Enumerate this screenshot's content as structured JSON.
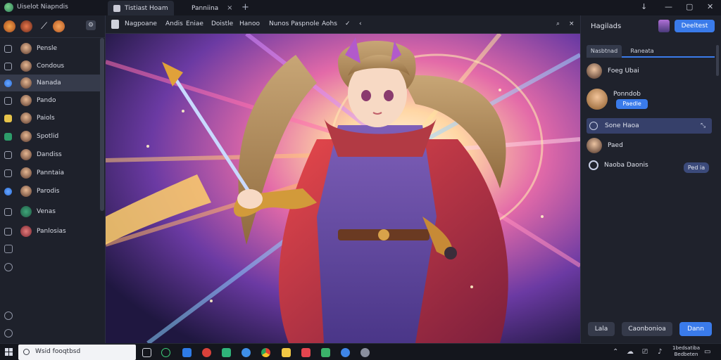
{
  "titlebar": {
    "app_title": "Uiselot Niapndis",
    "tabs": [
      {
        "label": "Tistiast Hoam",
        "close": "×",
        "active": true
      },
      {
        "label": "Panniina",
        "close": "×",
        "active": false
      }
    ],
    "new_tab": "+",
    "window_controls": [
      "↓",
      "—",
      "▢",
      "✕"
    ]
  },
  "sidebar": {
    "top_icons": [
      "flame-icon",
      "avatar-icon",
      "brush-icon",
      "coin-icon",
      "settings-icon"
    ],
    "items": [
      {
        "label": "Pensle",
        "icon": "pencil-icon",
        "selected": false
      },
      {
        "label": "Condous",
        "icon": "image-icon",
        "selected": false
      },
      {
        "label": "Nanada",
        "icon": "globe-icon",
        "selected": true
      },
      {
        "label": "Pando",
        "icon": "frame-icon",
        "selected": false
      },
      {
        "label": "Paiols",
        "icon": "folder-icon",
        "selected": false
      },
      {
        "label": "Spotlid",
        "icon": "chart-icon",
        "selected": false
      },
      {
        "label": "Dandiss",
        "icon": "square-icon",
        "selected": false
      },
      {
        "label": "Panntaia",
        "icon": "grid-icon",
        "selected": false
      },
      {
        "label": "Parodis",
        "icon": "circle-icon",
        "selected": false
      },
      {
        "label": "Venas",
        "icon": "box-icon",
        "selected": false
      },
      {
        "label": "Panlosias",
        "icon": "tile-icon",
        "selected": false
      }
    ],
    "bottom_icons": [
      "layers-icon",
      "refresh-icon",
      "help-icon",
      "info-icon"
    ]
  },
  "toolbar": {
    "items": [
      "Nagpoane",
      "Andis",
      "Eniae",
      "Doistle",
      "Hanoo",
      "Nunos Paspnole",
      "Aohs"
    ],
    "actions": [
      "✓",
      "‹"
    ],
    "right_actions": [
      "⌕",
      "×"
    ]
  },
  "right_panel": {
    "title": "Hagilads",
    "primary_button": "Deeltest",
    "tabs": [
      "Nasbtnad",
      "Raneata"
    ],
    "items": [
      {
        "label": "Foeg Ubai"
      },
      {
        "label": "Ponndob",
        "pill": "Paedle"
      },
      {
        "label": "Sone Haoa",
        "selected": true
      },
      {
        "label": "Paed"
      },
      {
        "label": "Naoba Daonis",
        "pill": "Ped ia"
      }
    ],
    "footer_buttons": [
      "Lala",
      "Caonbonioa",
      "Dann"
    ]
  },
  "taskbar": {
    "search_text": "Wsid fooqtbsd",
    "clock_line1": "1bedsatiba",
    "clock_line2": "Bedbeten"
  },
  "colors": {
    "accent": "#3a7bea",
    "panel": "#1f222c",
    "sidebar_selected": "#363b4b"
  }
}
